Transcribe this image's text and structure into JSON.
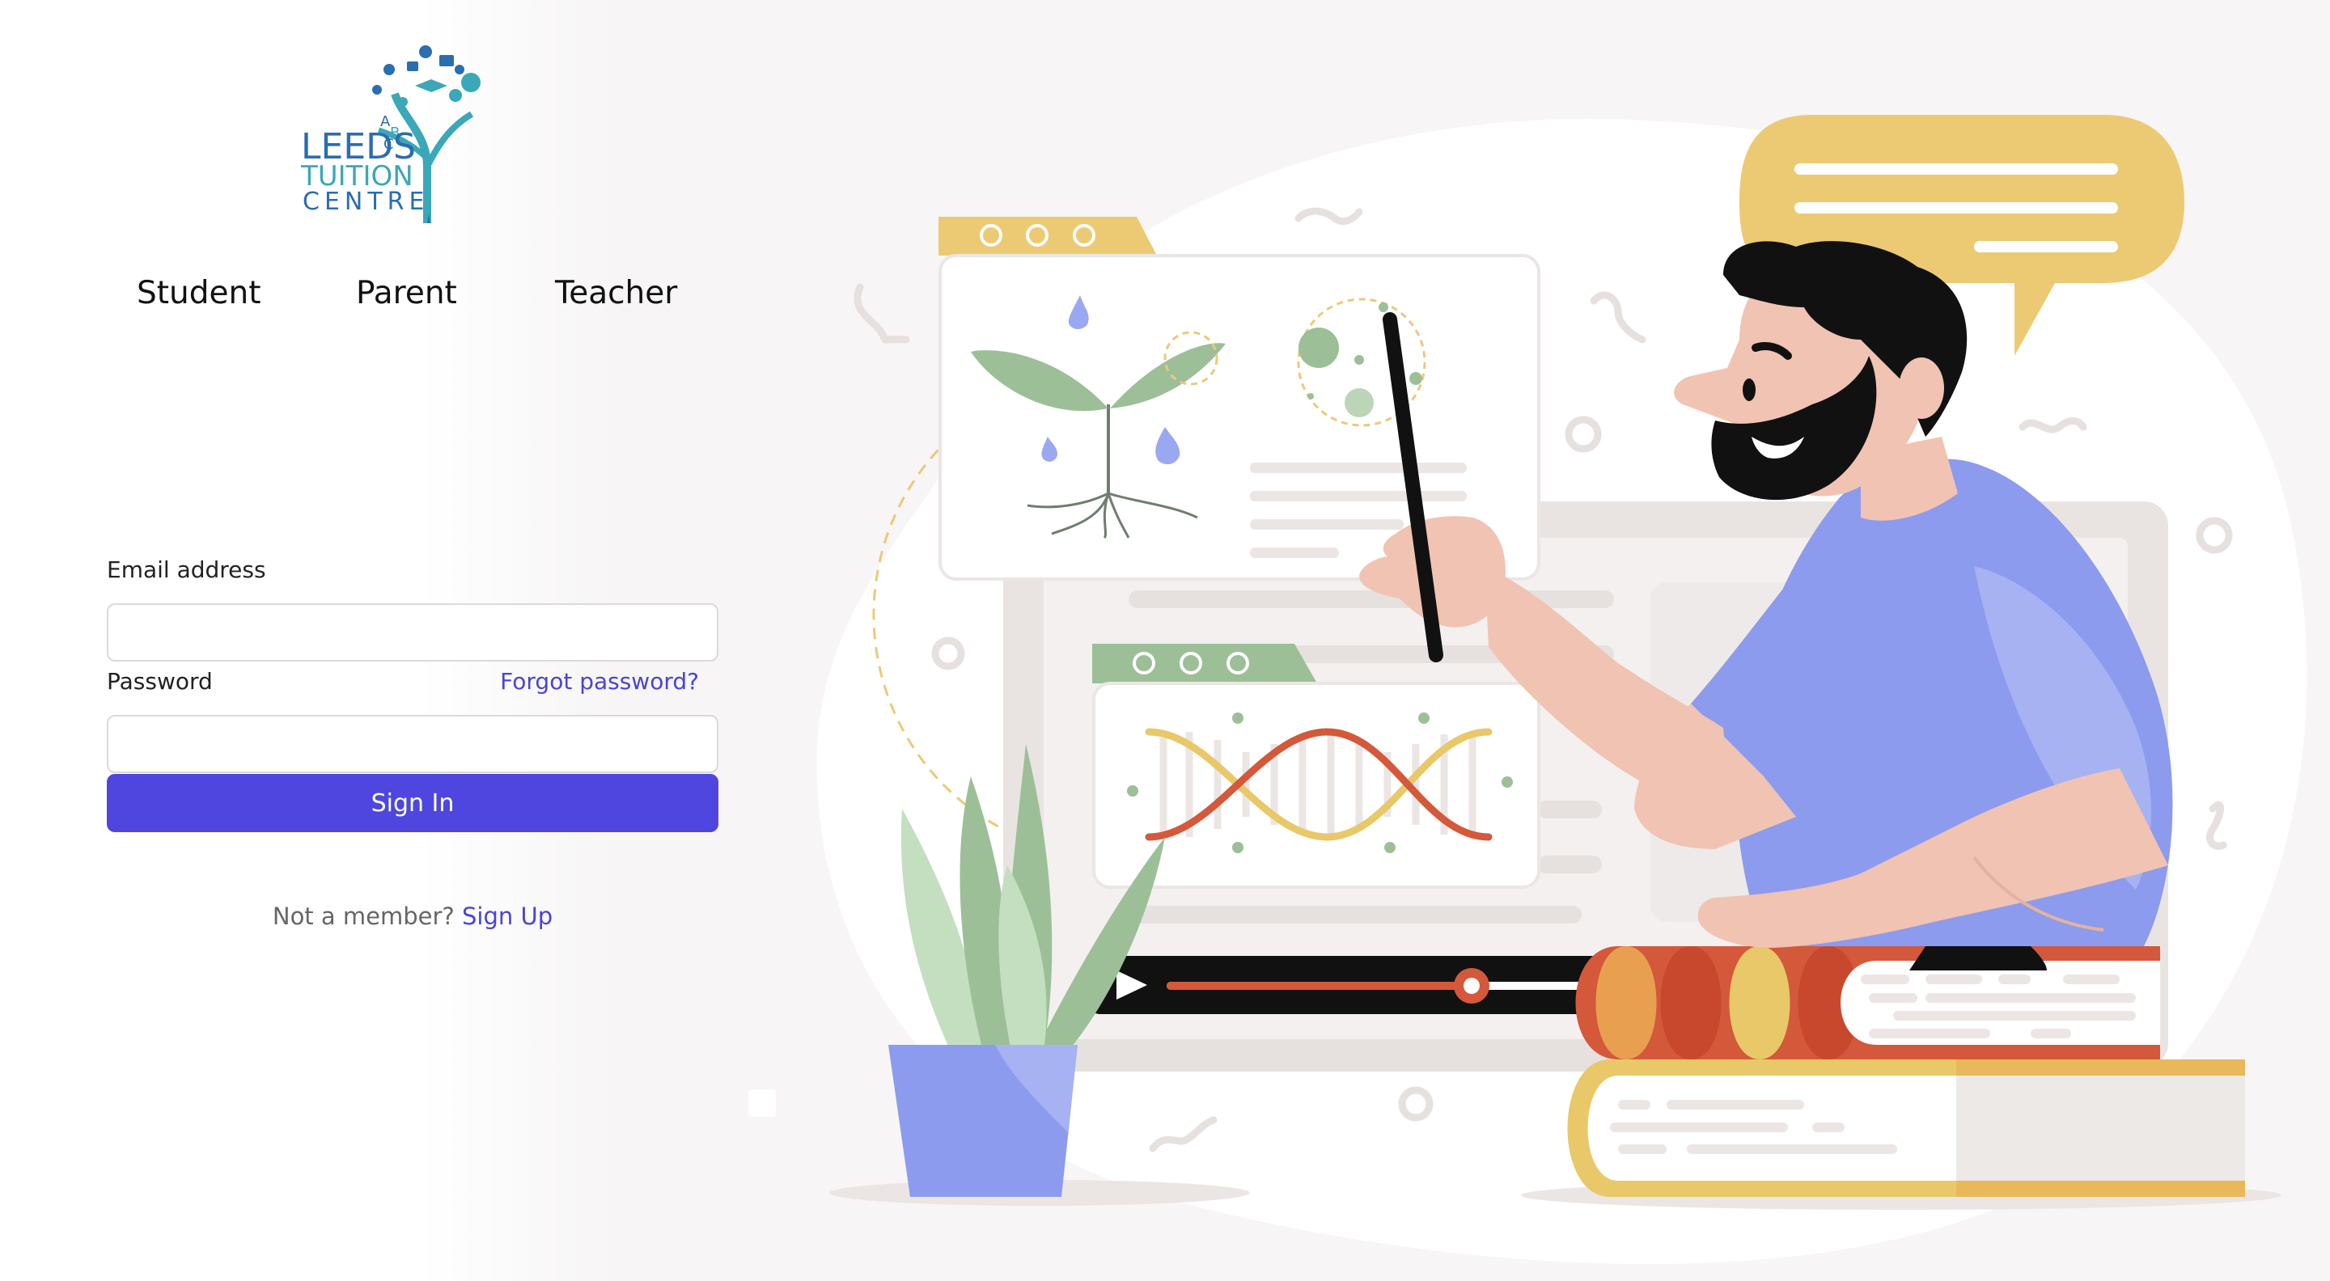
{
  "brand": {
    "line1": "LEEDS",
    "line2": "TUITION",
    "line3": "CENTRE"
  },
  "roles": [
    {
      "label": "Student"
    },
    {
      "label": "Parent"
    },
    {
      "label": "Teacher"
    }
  ],
  "form": {
    "email_label": "Email address",
    "email_value": "",
    "password_label": "Password",
    "password_value": "",
    "forgot_label": "Forgot password?",
    "submit_label": "Sign In",
    "member_prompt": "Not a member?",
    "signup_label": "Sign Up"
  },
  "colors": {
    "accent": "#4f46e0",
    "link": "#4a44d8",
    "shirt": "#8c9bee",
    "bubble": "#ecca74",
    "book_red": "#d4583a",
    "leaf_green": "#9cbf98"
  },
  "video": {
    "progress": 0.65
  },
  "icons": [
    "logo-tree-icon",
    "play-icon"
  ]
}
